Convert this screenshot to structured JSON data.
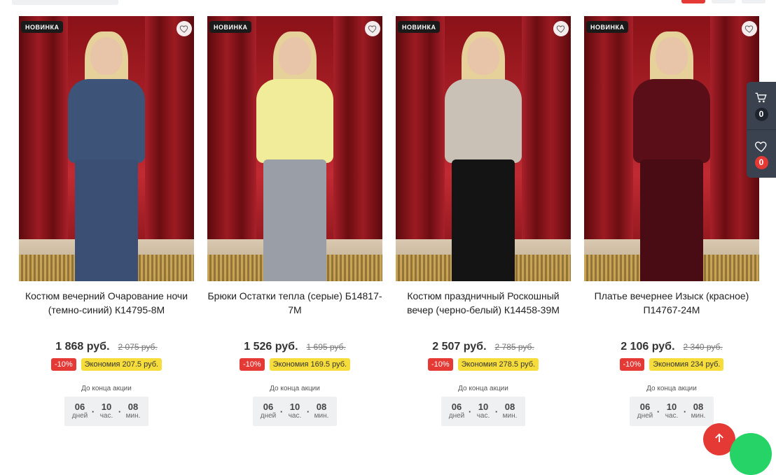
{
  "colors": {
    "accent": "#e53935",
    "economy_badge": "#f7dd3b",
    "side_panel": "#3a4250",
    "chat": "#25d366"
  },
  "timer_labels": {
    "days": "дней",
    "hours": "час.",
    "minutes": "мин."
  },
  "until_text": "До конца акции",
  "badge_new": "НОВИНКА",
  "products": [
    {
      "title": "Костюм вечерний Очарование ночи (темно-синий) К14795-8М",
      "price": "1 868 руб.",
      "old_price": "2 075 руб.",
      "discount": "-10%",
      "economy": "Экономия 207.5 руб.",
      "timer": {
        "days": "06",
        "hours": "10",
        "minutes": "08"
      },
      "has_video": false,
      "outfit_top": "#3d5378",
      "outfit_bottom": "#3a4f73"
    },
    {
      "title": "Брюки Остатки тепла (серые) Б14817-7М",
      "price": "1 526 руб.",
      "old_price": "1 695 руб.",
      "discount": "-10%",
      "economy": "Экономия 169.5 руб.",
      "timer": {
        "days": "06",
        "hours": "10",
        "minutes": "08"
      },
      "has_video": false,
      "outfit_top": "#f1ec9a",
      "outfit_bottom": "#9a9ea6"
    },
    {
      "title": "Костюм праздничный Роскошный вечер (черно-белый) К14458-39М",
      "price": "2 507 руб.",
      "old_price": "2 785 руб.",
      "discount": "-10%",
      "economy": "Экономия 278.5 руб.",
      "timer": {
        "days": "06",
        "hours": "10",
        "minutes": "08"
      },
      "has_video": true,
      "outfit_top": "#c9c1b6",
      "outfit_bottom": "#141414"
    },
    {
      "title": "Платье вечернее Изыск (красное) П14767-24М",
      "price": "2 106 руб.",
      "old_price": "2 340 руб.",
      "discount": "-10%",
      "economy": "Экономия 234 руб.",
      "timer": {
        "days": "06",
        "hours": "10",
        "minutes": "08"
      },
      "has_video": true,
      "outfit_top": "#5a0f18",
      "outfit_bottom": "#4a0c14"
    }
  ],
  "side_panel": {
    "cart_count": "0",
    "fav_count": "0"
  },
  "icons": {
    "favorite": "heart-icon",
    "video": "play-icon",
    "cart": "cart-icon",
    "scroll_top": "arrow-up-icon"
  }
}
